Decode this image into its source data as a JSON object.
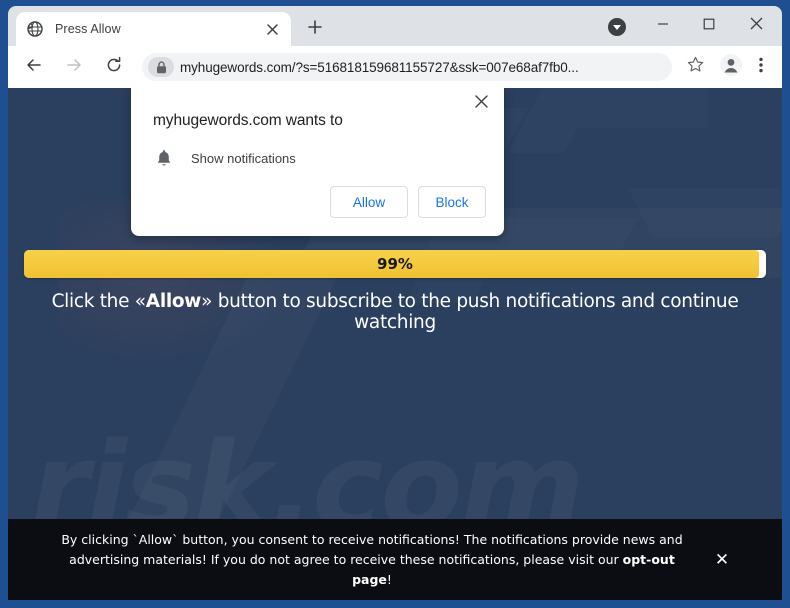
{
  "browser": {
    "tab": {
      "title": "Press Allow",
      "favicon_icon": "globe-icon",
      "close_icon": "close-icon"
    },
    "new_tab_icon": "plus-icon",
    "tab_search_icon": "chevron-down-circle-icon",
    "window_controls": {
      "minimize_icon": "minimize-icon",
      "maximize_icon": "maximize-icon",
      "close_icon": "close-icon"
    },
    "toolbar": {
      "back_icon": "arrow-left-icon",
      "forward_icon": "arrow-right-icon",
      "reload_icon": "reload-icon",
      "lock_icon": "lock-icon",
      "url": "myhugewords.com/?s=516818159681155727&ssk=007e68af7fb0...",
      "bookmark_icon": "star-icon",
      "profile_icon": "avatar-icon",
      "menu_icon": "kebab-menu-icon"
    }
  },
  "permission_dialog": {
    "title": "myhugewords.com wants to",
    "item_icon": "bell-icon",
    "item_label": "Show notifications",
    "allow_label": "Allow",
    "block_label": "Block",
    "close_icon": "close-icon"
  },
  "page": {
    "progress": {
      "percent": 99,
      "label": "99%"
    },
    "instruction": {
      "before": "Click the «",
      "emphasis": "Allow",
      "after": "» button to subscribe to the push notifications and continue watching"
    },
    "watermark_text": "risk.com",
    "consent_bar": {
      "line1": "By clicking `Allow` button, you consent to receive notifications! The notifications provide news and",
      "line2_before": "advertising materials! If you do not agree to receive these notifications, please visit our ",
      "line2_link": "opt-out page",
      "line2_after": "!",
      "close_icon": "close-icon"
    }
  },
  "colors": {
    "page_background": "#2b3f5e",
    "window_border": "#1d4f91",
    "progress_fill": "#f4c93c",
    "consent_background": "#0b0d12",
    "button_text": "#1a73e8"
  }
}
